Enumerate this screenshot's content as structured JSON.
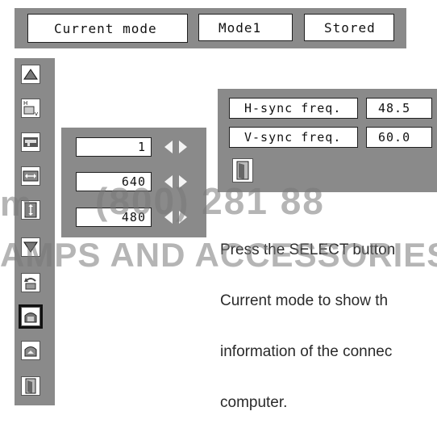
{
  "header": {
    "title": "Current mode",
    "mode_value": "Mode1",
    "stored_label": "Stored"
  },
  "sidebar": {
    "icons": [
      {
        "name": "triangle-up-icon"
      },
      {
        "name": "h-position-v-icon",
        "label_h": "H",
        "label_v": "v"
      },
      {
        "name": "clamp-icon"
      },
      {
        "name": "horizontal-size-icon"
      },
      {
        "name": "vertical-size-icon"
      },
      {
        "name": "triangle-down-icon"
      },
      {
        "name": "reset-icon"
      },
      {
        "name": "mode-free-icon"
      },
      {
        "name": "store-mode-icon"
      },
      {
        "name": "exit-door-icon"
      }
    ]
  },
  "adjust": {
    "rows": [
      {
        "value": "1"
      },
      {
        "value": "640"
      },
      {
        "value": "480"
      }
    ]
  },
  "info": {
    "hsync_label": "H-sync freq.",
    "hsync_value": "48.5",
    "vsync_label": "V-sync freq.",
    "vsync_value": "60.0"
  },
  "caption": {
    "lines": [
      "Press the SELECT button",
      "Current mode to show th",
      "information of the connec",
      "computer."
    ]
  },
  "watermark": {
    "phone": "(800) 281 88",
    "prefix": "m",
    "brand": "AMPS AND ACCESSORIES"
  },
  "colors": {
    "panel": "#8a8a8a",
    "border": "#202020",
    "arrow": "#f4f4f4"
  }
}
